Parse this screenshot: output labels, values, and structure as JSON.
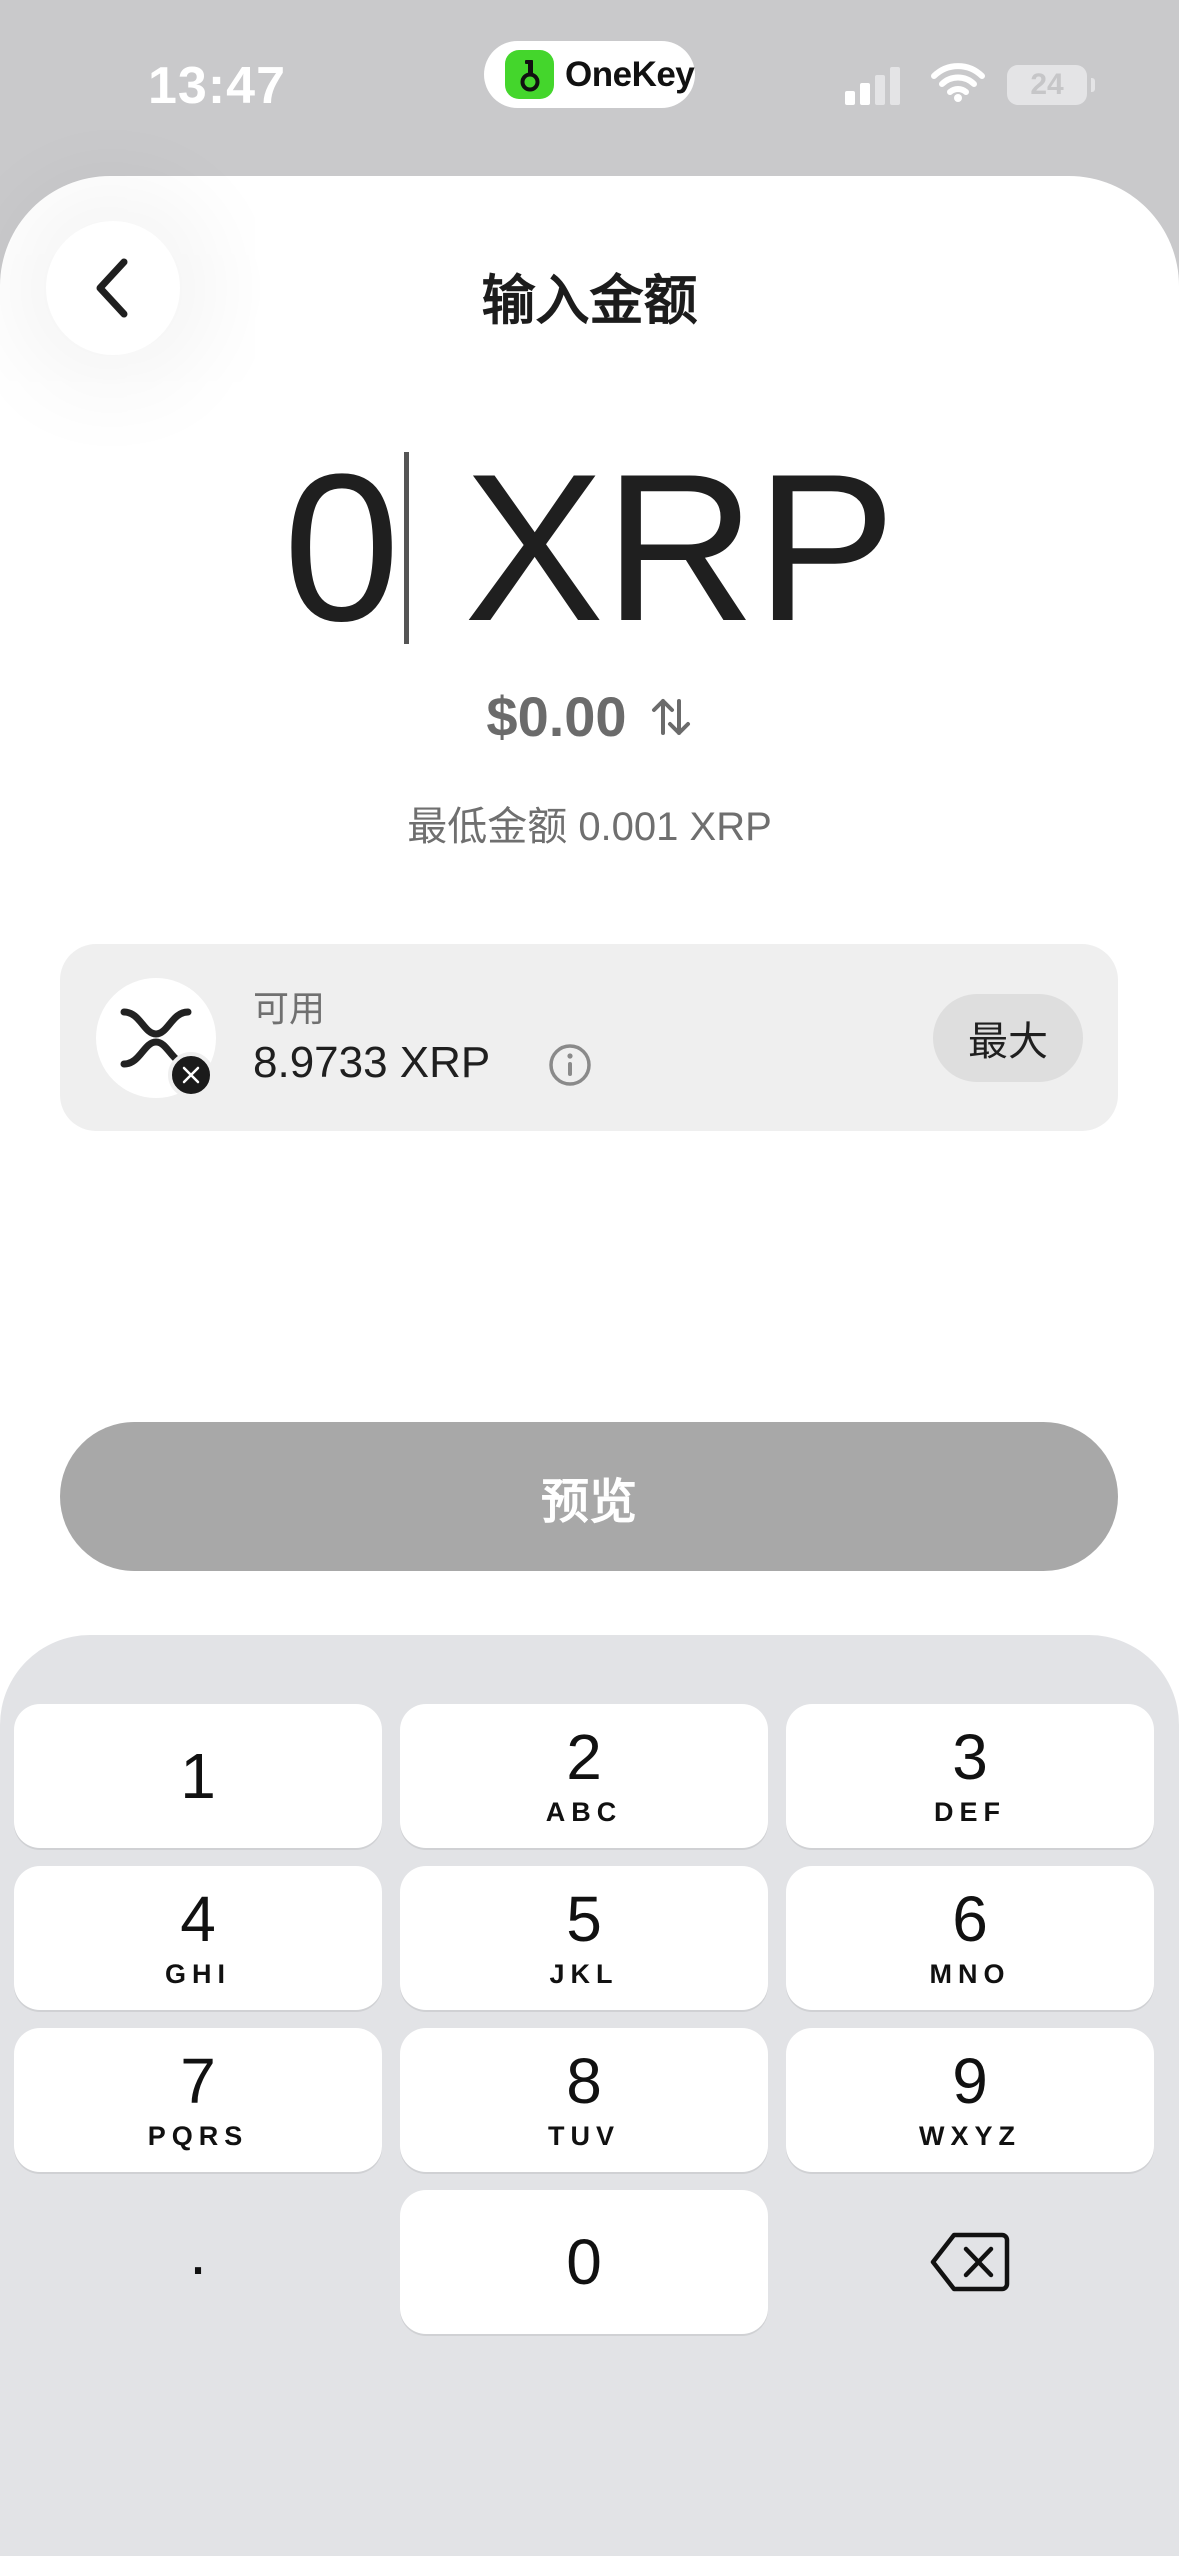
{
  "status_bar": {
    "time": "13:47",
    "brand": "OneKey",
    "battery": "24",
    "brand_color": "#44d62c"
  },
  "header": {
    "title": "输入金额",
    "back_icon": "chevron-left-icon"
  },
  "amount": {
    "value": "0",
    "unit": "XRP",
    "fiat": "$0.00",
    "swap_icon": "swap-vertical-icon",
    "min_note": "最低金额 0.001 XRP"
  },
  "balance": {
    "label": "可用",
    "value": "8.9733 XRP",
    "max_label": "最大",
    "token_icon": "xrp-logo-icon",
    "info_icon": "info-icon"
  },
  "actions": {
    "preview_label": "预览"
  },
  "keypad": {
    "keys": [
      {
        "num": "1",
        "sub": ""
      },
      {
        "num": "2",
        "sub": "ABC"
      },
      {
        "num": "3",
        "sub": "DEF"
      },
      {
        "num": "4",
        "sub": "GHI"
      },
      {
        "num": "5",
        "sub": "JKL"
      },
      {
        "num": "6",
        "sub": "MNO"
      },
      {
        "num": "7",
        "sub": "PQRS"
      },
      {
        "num": "8",
        "sub": "TUV"
      },
      {
        "num": "9",
        "sub": "WXYZ"
      },
      {
        "num": ".",
        "sub": ""
      },
      {
        "num": "0",
        "sub": ""
      },
      {
        "num": "",
        "sub": "",
        "icon": "backspace-icon"
      }
    ]
  }
}
